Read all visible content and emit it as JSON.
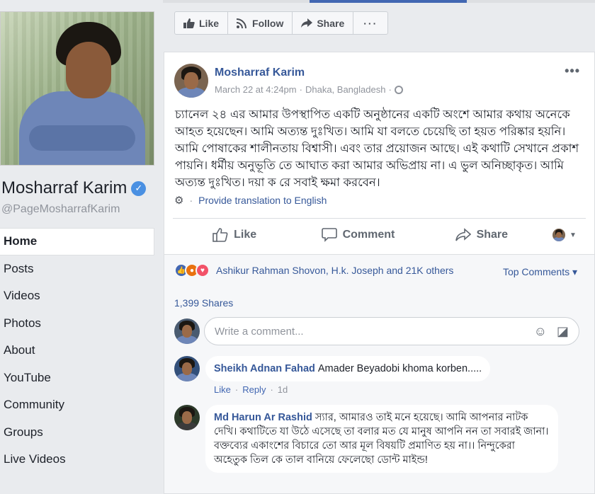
{
  "page": {
    "name": "Mosharraf Karim",
    "handle": "@PageMosharrafKarim",
    "nav": [
      "Home",
      "Posts",
      "Videos",
      "Photos",
      "About",
      "YouTube",
      "Community",
      "Groups",
      "Live Videos"
    ]
  },
  "action_bar": {
    "like": "Like",
    "follow": "Follow",
    "share": "Share",
    "more": "···"
  },
  "post": {
    "author": "Mosharraf Karim",
    "date": "March 22 at 4:24pm",
    "location": "Dhaka, Bangladesh",
    "separator": "·",
    "text": "চ্যানেল ২৪ এর আমার উপস্থাপিত একটি অনুষ্ঠানের একটি অংশে আমার কথায় অনেকে আহত হয়েছেন। আমি অত্যন্ত দুঃখিত। আমি যা বলতে চেয়েছি তা হয়ত পরিষ্কার হয়নি। আমি পোষাকের শালীনতায় বিশ্বাসী। এবং তার প্রয়োজন আছে। এই কথাটি সেখানে প্রকাশ পায়নি। ধর্মীয় অনুভূতি তে আঘাত করা আমার অভিপ্রায় না। এ ভুল অনিচ্ছাকৃত। আমি অত্যন্ত দুঃখিত। দয়া ক রে সবাই ক্ষমা করবেন।",
    "translate": "Provide translation to English",
    "actions": {
      "like": "Like",
      "comment": "Comment",
      "share": "Share"
    }
  },
  "feedback": {
    "reactors": "Ashikur Rahman Shovon, H.k. Joseph and 21K others",
    "top_comments": "Top Comments ▾",
    "shares": "1,399 Shares",
    "composer_placeholder": "Write a comment..."
  },
  "comments": [
    {
      "name": "Sheikh Adnan Fahad",
      "text": "Amader Beyadobi khoma korben.....",
      "like": "Like",
      "reply": "Reply",
      "time": "1d"
    },
    {
      "name": "Md Harun Ar Rashid",
      "text": "স্যার, আমারও তাই মনে হয়েছে। আমি আপনার নাটক দেখি। কথাটিতে যা উঠে এসেছে তা বলার মত যে মানুষ আপনি নন তা সবারই জানা। বক্তব্যের একাংশের বিচারে তো আর মূল বিষয়টি প্রমাণিত হয় না।। নিন্দুকেরা অহেতুক তিল কে তাল বানিয়ে ফেলেছো ডোন্ট মাইন্ড!"
    }
  ],
  "colors": {
    "link": "#365899",
    "accent": "#4267b2",
    "background": "#e9ebee"
  }
}
